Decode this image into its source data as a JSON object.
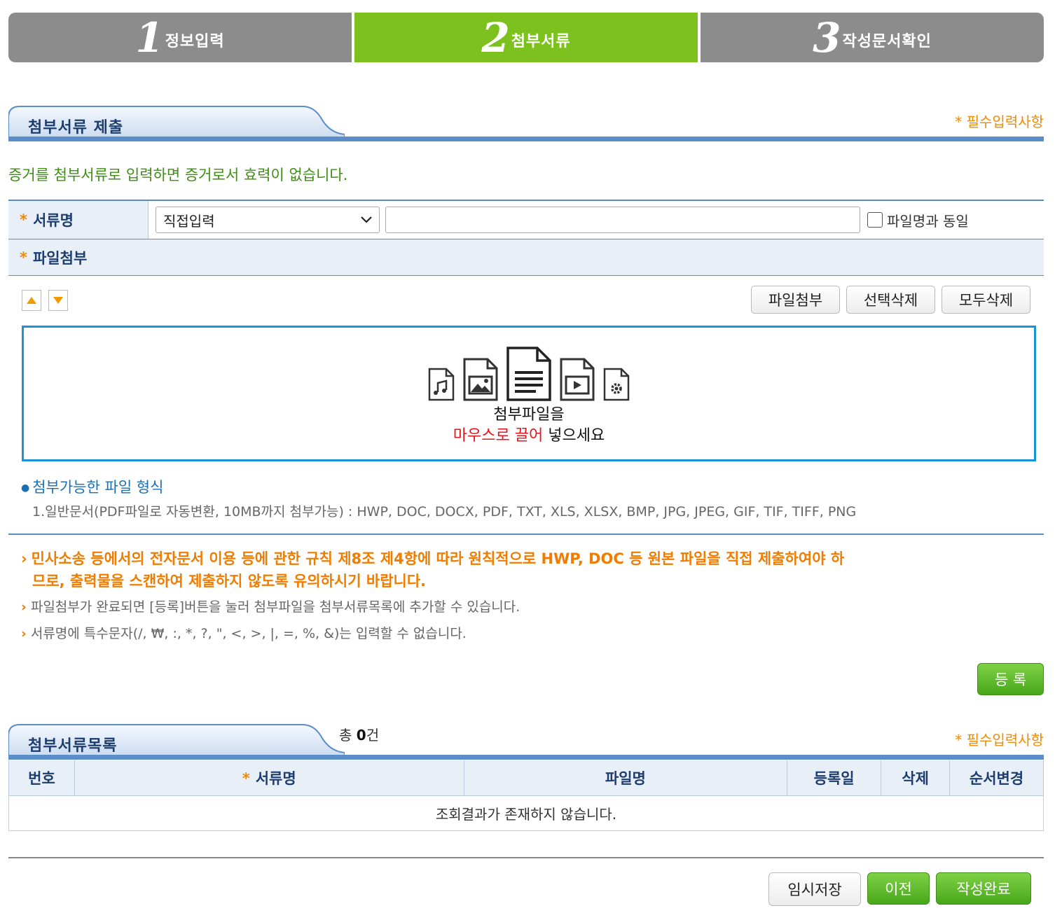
{
  "steps": [
    {
      "num": "1",
      "label": "정보입력"
    },
    {
      "num": "2",
      "label": "첨부서류"
    },
    {
      "num": "3",
      "label": "작성문서확인"
    }
  ],
  "attach_section": {
    "title": "첨부서류 제출",
    "required_note": "* 필수입력사항",
    "notice": "증거를 첨부서류로 입력하면 증거로서 효력이 없습니다."
  },
  "form": {
    "doc_name_label": "서류명",
    "doc_type_selected": "직접입력",
    "doc_name_value": "",
    "same_as_filename_label": "파일명과 동일",
    "file_attach_label": "파일첨부",
    "required_mark": "*"
  },
  "toolbar": {
    "attach_button": "파일첨부",
    "delete_selected_button": "선택삭제",
    "delete_all_button": "모두삭제"
  },
  "dropzone": {
    "line1": "첨부파일을",
    "line2_red": "마우스로 끌어",
    "line2_rest": " 넣으세요",
    "icons": [
      "music-file-icon",
      "image-file-icon",
      "document-file-icon",
      "video-file-icon",
      "settings-file-icon"
    ]
  },
  "formats": {
    "title": "첨부가능한 파일 형식",
    "line": "1.일반문서(PDF파일로 자동변환, 10MB까지 첨부가능) : HWP, DOC, DOCX, PDF, TXT, XLS, XLSX, BMP, JPG, JPEG, GIF, TIF, TIFF, PNG"
  },
  "notices": {
    "warning_line1": "민사소송 등에서의 전자문서 이용 등에 관한 규칙 제8조 제4항에 따라 원칙적으로 HWP, DOC 등 원본 파일을 직접 제출하여야 하",
    "warning_line2": "므로, 출력물을 스캔하여 제출하지 않도록 유의하시기 바랍니다.",
    "info1": "파일첨부가 완료되면 [등록]버튼을 눌러 첨부파일을 첨부서류목록에 추가할 수 있습니다.",
    "info2": "서류명에 특수문자(/, ₩, :, *, ?, \", <, >, |, =, %, &)는 입력할 수 없습니다."
  },
  "register_button": "등 록",
  "list_section": {
    "title": "첨부서류목록",
    "total_prefix": "총 ",
    "total_count": "0",
    "total_suffix": "건",
    "required_note": "* 필수입력사항",
    "columns": [
      "번호",
      "서류명",
      "파일명",
      "등록일",
      "삭제",
      "순서변경"
    ],
    "empty_message": "조회결과가 존재하지 않습니다."
  },
  "footer": {
    "temp_save": "임시저장",
    "prev": "이전",
    "complete": "작성완료"
  },
  "colors": {
    "active_step": "#7dc11f",
    "inactive_step": "#8c8c8c",
    "accent_blue": "#5b8ec8",
    "orange": "#f07c00",
    "green_button": "#48a71a",
    "dropzone_border": "#1a94d6"
  }
}
